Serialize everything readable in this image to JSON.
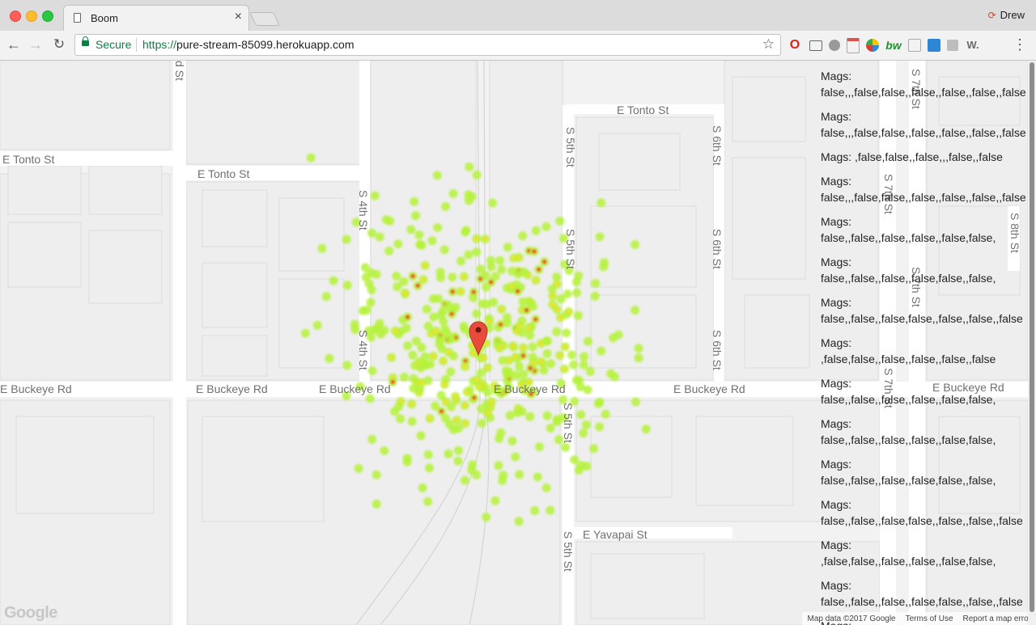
{
  "window": {
    "tab_title": "Boom",
    "tab_close": "×",
    "profile_name": "Drew",
    "profile_icon": "refresh-like-red-icon"
  },
  "toolbar": {
    "back": "←",
    "forward": "→",
    "reload": "↻",
    "secure_label": "Secure",
    "url_scheme": "https://",
    "url_host": "pure-stream-85099.herokuapp.com",
    "bookmark": "☆",
    "menu": "⋮",
    "extensions": {
      "opera": "O",
      "bw": "bw",
      "w": "W."
    }
  },
  "map": {
    "streets": {
      "tonto_left": "E Tonto St",
      "tonto_mid": "E Tonto St",
      "tonto_right": "E Tonto St",
      "buckeye_1": "E Buckeye Rd",
      "buckeye_2": "E Buckeye Rd",
      "buckeye_3": "E Buckeye Rd",
      "buckeye_4": "E Buckeye Rd",
      "buckeye_5": "E Buckeye Rd",
      "buckeye_6": "E Buckeye Rd",
      "yavapai": "E Yavapai St",
      "s3rd_top": "d St",
      "s4th_1": "S 4th St",
      "s4th_2": "S 4th St",
      "s5th_1": "S 5th St",
      "s5th_2": "S 5th St",
      "s5th_3": "S 5th St",
      "s5th_4": "S 5th St",
      "s6th_1": "S 6th St",
      "s6th_2": "S 6th St",
      "s6th_3": "S 6th St",
      "s7th_1": "S 7th St",
      "s7th_2": "S 7th St",
      "s7th_3": "S 7th St",
      "s7th_4": "S 7th St",
      "s8th": "S 8th St"
    },
    "google_logo": "Google",
    "attribution": {
      "data": "Map data ©2017 Google",
      "terms": "Terms of Use",
      "report": "Report a map error"
    },
    "heat_colors": {
      "low": "#b5f23a",
      "mid": "#f0e02a",
      "high": "#e8402a"
    },
    "marker_color": "#e84b3c"
  },
  "mags": [
    {
      "label": "Mags:",
      "value": "false,,,false,false,,false,,false,,false,,false"
    },
    {
      "label": "Mags:",
      "value": "false,,,false,false,,false,,false,,false,,false"
    },
    {
      "label": "Mags:",
      "value": ",false,false,,false,,,false,,false"
    },
    {
      "label": "Mags:",
      "value": "false,,,false,false,,false,,false,,false,,false"
    },
    {
      "label": "Mags:",
      "value": "false,,false,,false,,false,,false,false,"
    },
    {
      "label": "Mags:",
      "value": "false,,false,,false,,false,false,,false,"
    },
    {
      "label": "Mags:",
      "value": "false,,false,,false,false,,false,,false,,false"
    },
    {
      "label": "Mags:",
      "value": ",false,false,,false,,false,,false,,false"
    },
    {
      "label": "Mags:",
      "value": "false,,false,,false,,false,,false,false,"
    },
    {
      "label": "Mags:",
      "value": "false,,false,,false,,false,,false,false,"
    },
    {
      "label": "Mags:",
      "value": "false,,false,,false,,false,false,,false,"
    },
    {
      "label": "Mags:",
      "value": "false,,false,,false,false,,false,,false,,false"
    },
    {
      "label": "Mags:",
      "value": ",false,false,,false,,false,,false,false,"
    },
    {
      "label": "Mags:",
      "value": "false,,false,,false,,false,false,,false,,false"
    },
    {
      "label": "Mags:",
      "value": ""
    }
  ]
}
